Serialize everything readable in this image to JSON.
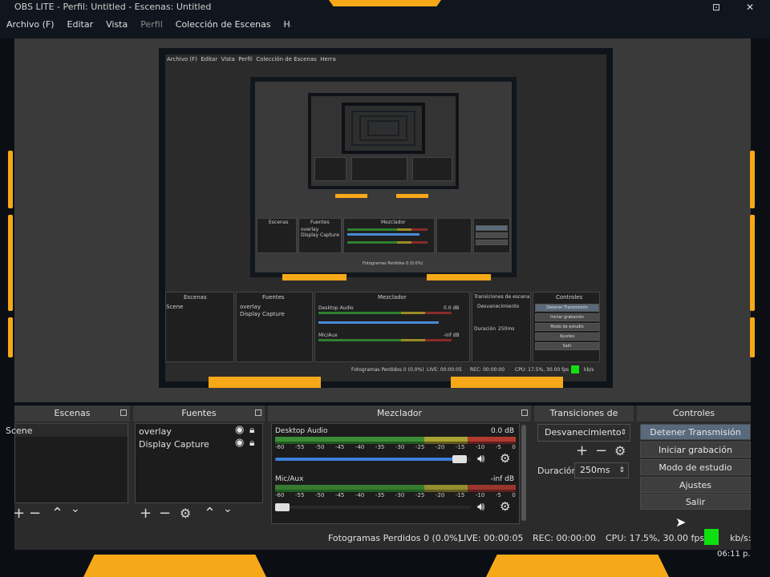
{
  "window": {
    "title": "OBS LITE - Perfil: Untitled - Escenas: Untitled",
    "controls": [
      "⊡",
      "✕"
    ]
  },
  "menu": {
    "items": [
      {
        "label": "Archivo (F)",
        "disabled": false
      },
      {
        "label": "Editar",
        "disabled": false
      },
      {
        "label": "Vista",
        "disabled": false
      },
      {
        "label": "Perfil",
        "disabled": true
      },
      {
        "label": "Colección de Escenas",
        "disabled": false
      },
      {
        "label": "Herra",
        "disabled": false
      }
    ]
  },
  "colors": {
    "accent": "#f7a819",
    "live": "#10e010",
    "panel": "#2b2b2b"
  },
  "preview": {
    "nested_panels": {
      "escenas": "Escenas",
      "fuentes": "Fuentes",
      "mezclador": "Mezclador",
      "transiciones": "Transiciones de escena",
      "controles": "Controles",
      "menu": [
        "Archivo (F)",
        "Editar",
        "Vista",
        "Perfil",
        "Colección de Escenas",
        "Herra"
      ],
      "sources": [
        "overlay",
        "Display Capture"
      ],
      "scene": "Scene",
      "desktop": "Desktop Audio",
      "desktop_db": "0.0 dB",
      "mic": "Mic/Aux",
      "mic_db": "-inf dB",
      "transition": "Desvanecimiento",
      "duration_label": "Duración",
      "duration": "250ms",
      "buttons": [
        "Detener Transmisión",
        "Iniciar grabación",
        "Modo de estudio",
        "Ajustes",
        "Salir"
      ],
      "status": [
        "Fotogramas Perdidos 0 (0.0%)",
        "LIVE: 00:00:05",
        "REC: 00:00:00",
        "CPU: 17.5%, 30.00 fps"
      ],
      "kbps": "kb/s"
    }
  },
  "scenes": {
    "title": "Escenas",
    "items": [
      "Scene"
    ]
  },
  "sources": {
    "title": "Fuentes",
    "items": [
      "overlay",
      "Display Capture"
    ]
  },
  "mixer": {
    "title": "Mezclador",
    "channels": [
      {
        "name": "Desktop Audio",
        "db": "0.0 dB",
        "volume_fraction": 0.98
      },
      {
        "name": "Mic/Aux",
        "db": "-inf dB",
        "volume_fraction": 0.03
      }
    ],
    "scale": [
      "-60",
      "-55",
      "-50",
      "-45",
      "-40",
      "-35",
      "-30",
      "-25",
      "-20",
      "-15",
      "-10",
      "-5",
      "0"
    ]
  },
  "transitions": {
    "title": "Transiciones de escena",
    "selected": "Desvanecimiento",
    "duration_label": "Duración",
    "duration_value": "250ms"
  },
  "controls": {
    "title": "Controles",
    "buttons": [
      "Detener Transmisión",
      "Iniciar grabación",
      "Modo de estudio",
      "Ajustes",
      "Salir"
    ]
  },
  "status": {
    "dropped": "Fotogramas Perdidos 0 (0.0%)",
    "live": "LIVE: 00:00:05",
    "rec": "REC: 00:00:00",
    "cpu": "CPU: 17.5%, 30.00 fps",
    "kbps": "kb/s:",
    "clock": "06:11 p."
  }
}
